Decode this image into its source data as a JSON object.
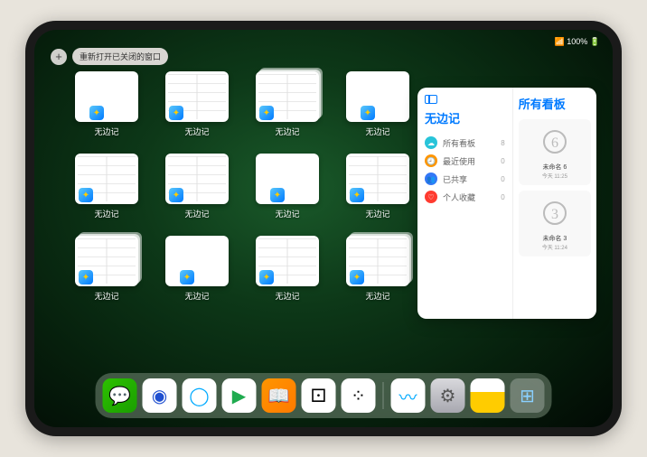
{
  "status": {
    "time": "",
    "indicators": "📶 100% 🔋"
  },
  "restore": {
    "plus": "+",
    "label": "重新打开已关闭的窗口"
  },
  "window_app_label": "无边记",
  "windows": [
    {
      "type": "simple",
      "label": "无边记"
    },
    {
      "type": "detailed",
      "label": "无边记"
    },
    {
      "type": "stacked",
      "label": "无边记"
    },
    {
      "type": "hidden",
      "label": ""
    },
    {
      "type": "simple",
      "label": "无边记"
    },
    {
      "type": "detailed",
      "label": "无边记"
    },
    {
      "type": "detailed",
      "label": "无边记"
    },
    {
      "type": "hidden",
      "label": ""
    },
    {
      "type": "simple",
      "label": "无边记"
    },
    {
      "type": "detailed",
      "label": "无边记"
    },
    {
      "type": "stacked",
      "label": "无边记"
    },
    {
      "type": "hidden",
      "label": ""
    },
    {
      "type": "simple",
      "label": "无边记"
    },
    {
      "type": "detailed",
      "label": "无边记"
    },
    {
      "type": "stacked",
      "label": "无边记"
    }
  ],
  "panel": {
    "app_title": "无边记",
    "right_title": "所有看板",
    "more": "⋯",
    "menu": [
      {
        "icon_color": "#28c4d9",
        "glyph": "☁",
        "label": "所有看板",
        "count": "8"
      },
      {
        "icon_color": "#ff9500",
        "glyph": "🕘",
        "label": "最近使用",
        "count": "0"
      },
      {
        "icon_color": "#3478f6",
        "glyph": "👥",
        "label": "已共享",
        "count": "0"
      },
      {
        "icon_color": "#ff3b30",
        "glyph": "♡",
        "label": "个人收藏",
        "count": "0"
      }
    ],
    "boards": [
      {
        "sketch": "6",
        "name": "未命名 6",
        "time": "今天 11:25"
      },
      {
        "sketch": "3",
        "name": "未命名 3",
        "time": "今天 11:24"
      }
    ]
  },
  "dock": [
    {
      "name": "wechat",
      "bg": "linear-gradient(135deg,#2dc100,#1a9e00)",
      "glyph": "💬",
      "glyph_color": "#fff"
    },
    {
      "name": "app-blue-circle",
      "bg": "#fff",
      "glyph": "◉",
      "glyph_color": "#2050d0"
    },
    {
      "name": "qq-browser",
      "bg": "#fff",
      "glyph": "◯",
      "glyph_color": "#00aaff"
    },
    {
      "name": "play",
      "bg": "#fff",
      "glyph": "▶",
      "glyph_color": "#1fab4f"
    },
    {
      "name": "books",
      "bg": "linear-gradient(135deg,#ff9500,#ff7a00)",
      "glyph": "📖",
      "glyph_color": "#fff"
    },
    {
      "name": "game-die",
      "bg": "#fff",
      "glyph": "⚀",
      "glyph_color": "#000"
    },
    {
      "name": "connect",
      "bg": "#fff",
      "glyph": "⁘",
      "glyph_color": "#000"
    },
    {
      "name": "sep"
    },
    {
      "name": "freeform",
      "bg": "#fff",
      "glyph": "〰",
      "glyph_color": "#00aaff"
    },
    {
      "name": "settings",
      "bg": "linear-gradient(180deg,#d8d8dc,#a8a8b0)",
      "glyph": "⚙",
      "glyph_color": "#555"
    },
    {
      "name": "notes",
      "bg": "linear-gradient(180deg,#fff 40%,#ffcc00 40%)",
      "glyph": "",
      "glyph_color": ""
    },
    {
      "name": "app-library",
      "bg": "rgba(255,255,255,0.25)",
      "glyph": "⊞",
      "glyph_color": "#8ad0ff"
    }
  ]
}
